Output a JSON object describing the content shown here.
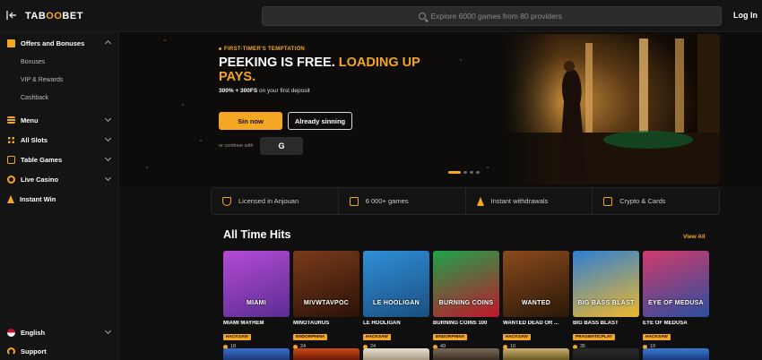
{
  "header": {
    "logo_text": "TAB",
    "logo_mid": "OO",
    "logo_end": "BET",
    "search_placeholder": "Explore 6000 games from 80 providers",
    "login_label": "Log In"
  },
  "sidebar": {
    "sections": [
      {
        "label": "Offers and Bonuses",
        "icon": "gift-icon",
        "expanded": true
      },
      {
        "label": "Menu",
        "icon": "menu-icon"
      },
      {
        "label": "All Slots",
        "icon": "slots-icon"
      },
      {
        "label": "Table Games",
        "icon": "cards-icon"
      },
      {
        "label": "Live Casino",
        "icon": "chip-icon"
      },
      {
        "label": "Instant Win",
        "icon": "bolt-icon"
      }
    ],
    "subitems": [
      "Bonuses",
      "VIP & Rewards",
      "Cashback"
    ],
    "language": "English",
    "support": "Support"
  },
  "hero": {
    "eyebrow": "FIRST-TIMER'S TEMPTATION",
    "headline_white": "PEEKING IS FREE. ",
    "headline_accent": "LOADING UP PAYS.",
    "offer_bold": "300% + 300FS",
    "offer_rest": " on your first deposit",
    "primary_button": "Sin now",
    "secondary_button": "Already sinning",
    "continue_text": "or continue with",
    "google_letter": "G",
    "slides": 4,
    "active_slide": 1
  },
  "features": [
    {
      "label": "Licensed in Anjouan",
      "icon": "shield-icon"
    },
    {
      "label": "6 000+ games",
      "icon": "gamepad-icon"
    },
    {
      "label": "Instant withdrawals",
      "icon": "bolt-icon"
    },
    {
      "label": "Crypto & Cards",
      "icon": "wallet-icon"
    }
  ],
  "games_section": {
    "title": "All Time Hits",
    "view_all": "View All",
    "games": [
      {
        "name": "MIAMI MAYHEM",
        "provider": "HACKSAW",
        "players": "18",
        "art": "MIAMI",
        "color1": "#b44bd6",
        "color2": "#5a2d91"
      },
      {
        "name": "MINOTAURUS",
        "provider": "ENDORPHINA",
        "players": "24",
        "art": "MIVWTAVPOC",
        "color1": "#7a3b1a",
        "color2": "#2a1208"
      },
      {
        "name": "LE HOOLIGAN",
        "provider": "HACKSAW",
        "players": "24",
        "art": "LE HOOLIGAN",
        "color1": "#2f8fd8",
        "color2": "#1a4f80"
      },
      {
        "name": "BURNING COINS 100",
        "provider": "ENDORPHINA",
        "players": "49",
        "art": "BURNING COINS",
        "color1": "#1ea34a",
        "color2": "#c0172b"
      },
      {
        "name": "WANTED DEAD OR ...",
        "provider": "HACKSAW",
        "players": "10",
        "art": "WANTED",
        "color1": "#8a4a1c",
        "color2": "#2a1808"
      },
      {
        "name": "BIG BASS BLAST",
        "provider": "PRAGMATICPLAY",
        "players": "35",
        "art": "BIG BASS BLAST",
        "color1": "#2c7fd6",
        "color2": "#f0b72c"
      },
      {
        "name": "EYE OF MEDUSA",
        "provider": "HACKSAW",
        "players": "10",
        "art": "EYE OF MEDUSA",
        "color1": "#d13a6b",
        "color2": "#2a4fa0"
      }
    ]
  },
  "colors": {
    "accent": "#f5a623",
    "bg": "#0f0f0f",
    "panel": "#141414"
  }
}
